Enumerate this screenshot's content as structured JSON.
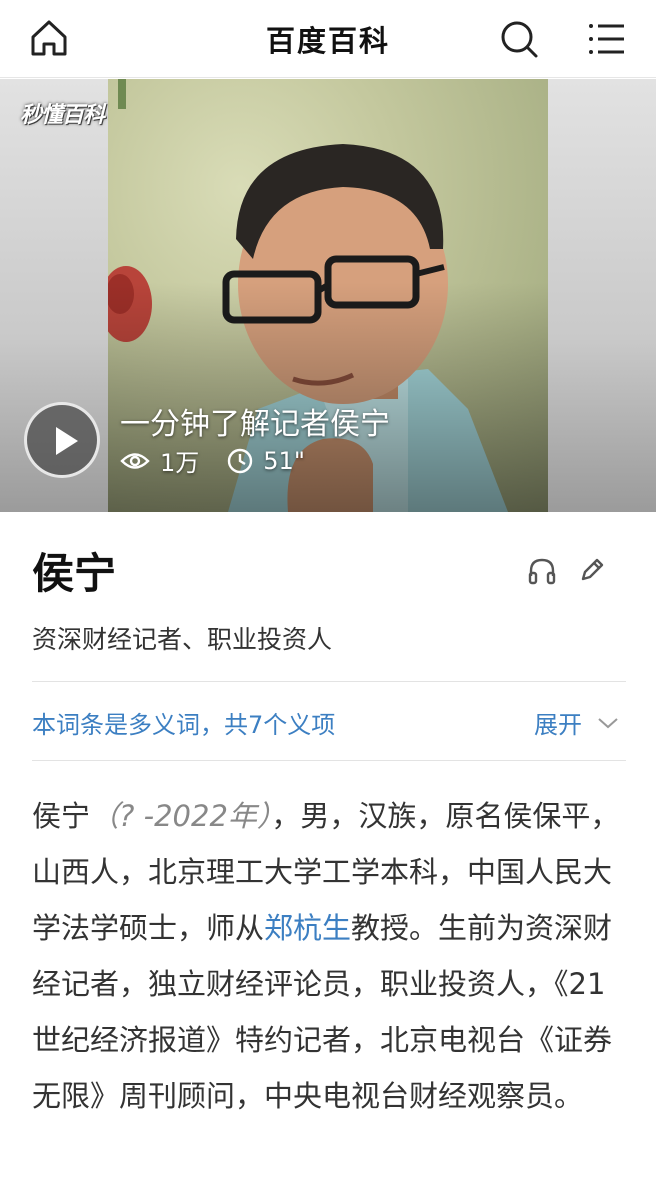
{
  "header": {
    "title": "百度百科"
  },
  "video": {
    "logo": "秒懂百科",
    "title": "一分钟了解记者侯宁",
    "views": "1万",
    "duration": "51\""
  },
  "entry": {
    "title": "侯宁",
    "subtitle": "资深财经记者、职业投资人"
  },
  "polysemy": {
    "text": "本词条是多义词，共7个义项",
    "expand_label": "展开"
  },
  "summary": {
    "name": "侯宁",
    "lifespan": "（? -2022年）",
    "part1": "，男，汉族，原名侯保平，山西人，北京理工大学工学本科，中国人民大学法学硕士，师从",
    "link": "郑杭生",
    "part2": "教授。生前为资深财经记者，独立财经评论员，职业投资人，《21世纪经济报道》特约记者，北京电视台《证券无限》周刊顾问，中央电视台财经观察员。"
  },
  "colors": {
    "link": "#3c7fc2",
    "text": "#333333"
  }
}
